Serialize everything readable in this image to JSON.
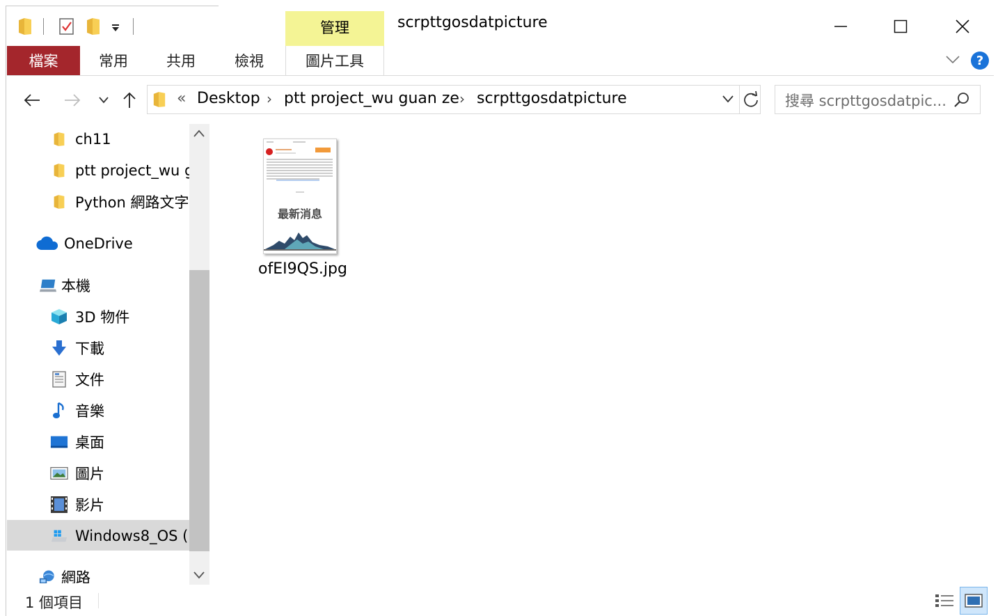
{
  "window": {
    "title": "scrpttgosdatpicture",
    "context_tab_group": "管理"
  },
  "ribbon": {
    "tabs": [
      {
        "label": "檔案"
      },
      {
        "label": "常用"
      },
      {
        "label": "共用"
      },
      {
        "label": "檢視"
      },
      {
        "label": "圖片工具"
      }
    ]
  },
  "address": {
    "overflow": "«",
    "segments": [
      "Desktop",
      "ptt project_wu guan ze",
      "scrpttgosdatpicture"
    ],
    "search_placeholder": "搜尋 scrpttgosdatpic..."
  },
  "nav": {
    "items": [
      {
        "label": "ch11",
        "icon": "folder-icon"
      },
      {
        "label": "ptt project_wu g",
        "icon": "folder-icon"
      },
      {
        "label": "Python 網路文字",
        "icon": "folder-icon"
      },
      {
        "label": "OneDrive",
        "icon": "cloud-icon"
      },
      {
        "label": "本機",
        "icon": "computer-icon"
      },
      {
        "label": "3D 物件",
        "icon": "cube-icon"
      },
      {
        "label": "下載",
        "icon": "download-icon"
      },
      {
        "label": "文件",
        "icon": "document-icon"
      },
      {
        "label": "音樂",
        "icon": "music-icon"
      },
      {
        "label": "桌面",
        "icon": "desktop-icon"
      },
      {
        "label": "圖片",
        "icon": "pictures-icon"
      },
      {
        "label": "影片",
        "icon": "video-icon"
      },
      {
        "label": "Windows8_OS (",
        "icon": "drive-icon"
      },
      {
        "label": "網路",
        "icon": "network-icon"
      }
    ]
  },
  "files": [
    {
      "name": "ofEI9QS.jpg",
      "preview_text": "最新消息"
    }
  ],
  "status": {
    "count": "1 個項目"
  },
  "colors": {
    "file_tab": "#a4262c",
    "context_band": "#f4f495",
    "help": "#1a73d9",
    "selected": "#d9d9d9"
  }
}
